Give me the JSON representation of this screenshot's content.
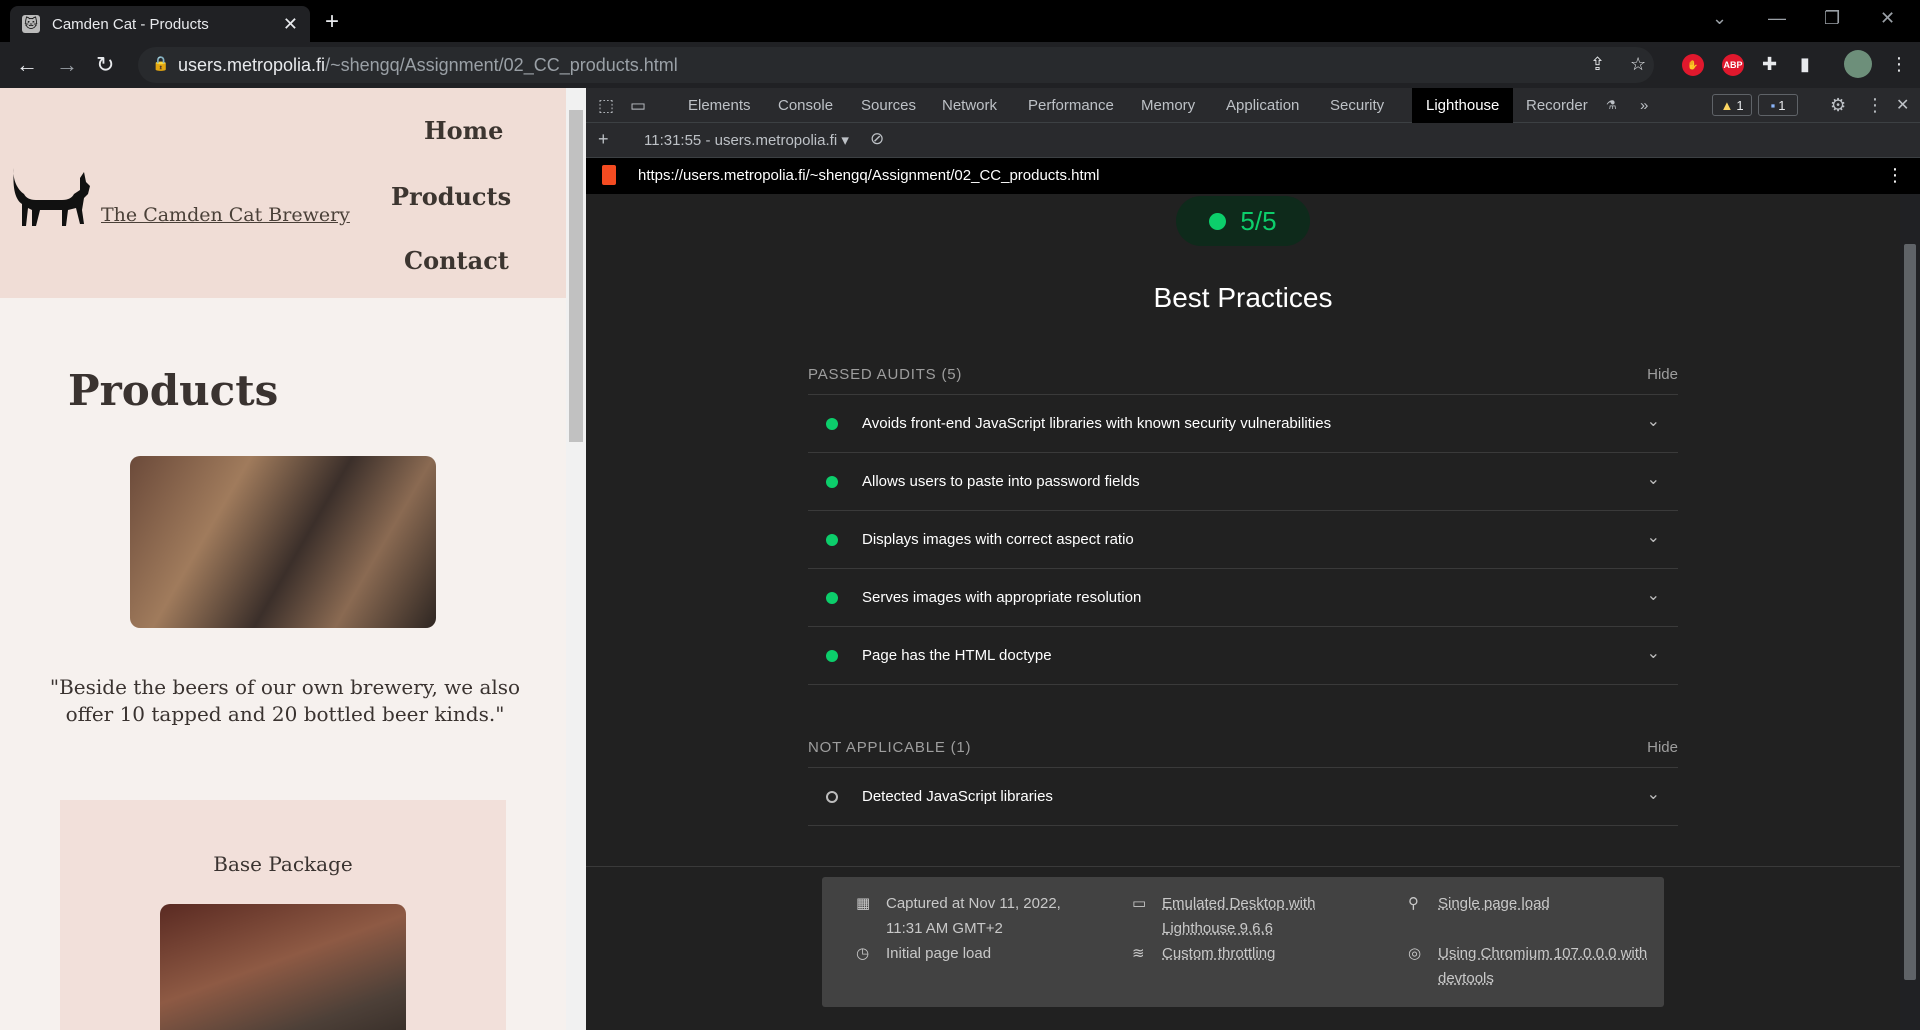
{
  "browser": {
    "tab_title": "Camden Cat - Products",
    "url_host": "users.metropolia.fi",
    "url_path": "/~shengq/Assignment/02_CC_products.html"
  },
  "site": {
    "nav": [
      "Home",
      "Products",
      "Contact"
    ],
    "brand": "The Camden Cat Brewery",
    "title": "Products",
    "quote": "\"Beside the beers of our own brewery, we also offer 10 tapped and 20 bottled beer kinds.\"",
    "card_title": "Base Package"
  },
  "devtools": {
    "tabs": [
      "Elements",
      "Console",
      "Sources",
      "Network",
      "Performance",
      "Memory",
      "Application",
      "Security",
      "Lighthouse",
      "Recorder"
    ],
    "active_tab": "Lighthouse",
    "more": "»",
    "warnings": "1",
    "messages": "1",
    "report_label": "11:31:55 - users.metropolia.fi",
    "report_url": "https://users.metropolia.fi/~shengq/Assignment/02_CC_products.html"
  },
  "lighthouse": {
    "score": "5/5",
    "category": "Best Practices",
    "passed_header": "PASSED AUDITS (5)",
    "na_header": "NOT APPLICABLE (1)",
    "hide": "Hide",
    "passed": [
      "Avoids front-end JavaScript libraries with known security vulnerabilities",
      "Allows users to paste into password fields",
      "Displays images with correct aspect ratio",
      "Serves images with appropriate resolution",
      "Page has the HTML doctype"
    ],
    "not_applicable": [
      "Detected JavaScript libraries"
    ],
    "runtime": {
      "captured_1": "Captured at Nov 11, 2022,",
      "captured_2": "11:31 AM GMT+2",
      "page_load": "Initial page load",
      "emulated_1": "Emulated Desktop with",
      "emulated_2": "Lighthouse 9.6.6",
      "throttling": "Custom throttling",
      "single": "Single page load",
      "chromium_1": "Using Chromium 107.0.0.0 with",
      "chromium_2": "devtools"
    },
    "colors": {
      "pass": "#0cce6b",
      "score_bg": "#0e2a1b"
    }
  }
}
